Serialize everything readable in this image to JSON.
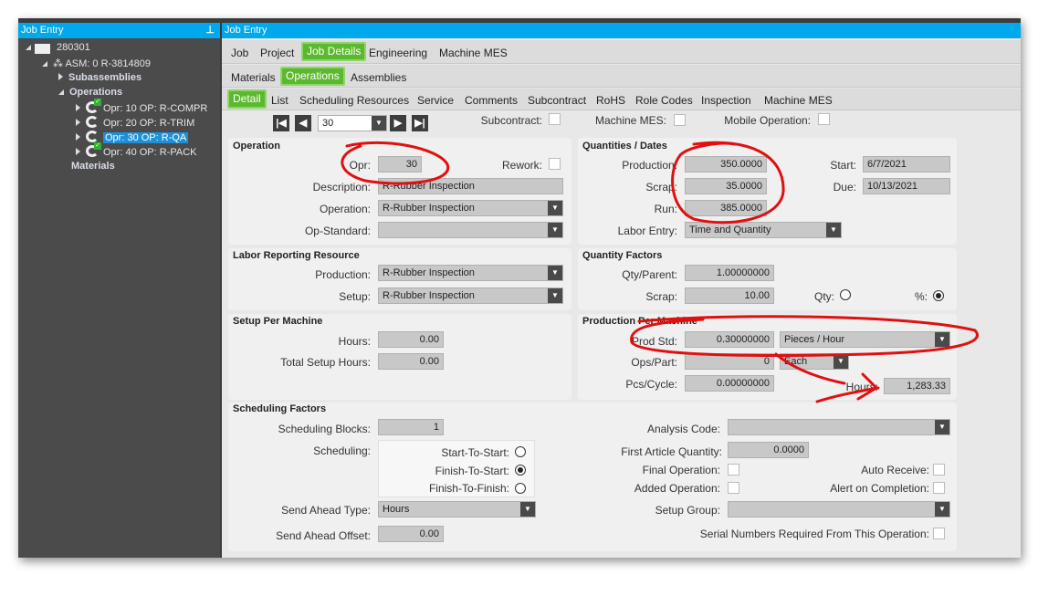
{
  "left_panel": {
    "title": "Job Entry",
    "pin_icon": "pin-icon",
    "tree": {
      "job": "280301",
      "assembly": "ASM: 0 R-3814809",
      "subassemblies": "Subassemblies",
      "operations": "Operations",
      "ops": [
        {
          "label": "Opr: 10 OP: R-COMPR",
          "complete": true
        },
        {
          "label": "Opr: 20 OP: R-TRIM",
          "complete": false
        },
        {
          "label": "Opr: 30 OP: R-QA",
          "complete": false,
          "selected": true
        },
        {
          "label": "Opr: 40 OP: R-PACK",
          "complete": true
        }
      ],
      "materials": "Materials"
    }
  },
  "main": {
    "title": "Job Entry",
    "tabs1": [
      "Job",
      "Project",
      "Job Details",
      "Engineering",
      "Machine MES"
    ],
    "tabs2": [
      "Materials",
      "Operations",
      "Assemblies"
    ],
    "tabs3": [
      "Detail",
      "List",
      "Scheduling Resources",
      "Service",
      "Comments",
      "Subcontract",
      "RoHS",
      "Role Codes",
      "Inspection",
      "Machine MES"
    ],
    "accent": "#5cb82e",
    "header_color": "#00a8ec",
    "nav": {
      "value": "30",
      "subcontract": "Subcontract:",
      "machine_mes": "Machine MES:",
      "mobile": "Mobile Operation:"
    }
  },
  "operation": {
    "title": "Operation",
    "opr_label": "Opr:",
    "opr": "30",
    "rework_label": "Rework:",
    "desc_label": "Description:",
    "desc": "R-Rubber Inspection",
    "op_label": "Operation:",
    "op": "R-Rubber Inspection",
    "std_label": "Op-Standard:",
    "std": ""
  },
  "quantities": {
    "title": "Quantities / Dates",
    "prod_label": "Production:",
    "prod": "350.0000",
    "scrap_label": "Scrap:",
    "scrap": "35.0000",
    "run_label": "Run:",
    "run": "385.0000",
    "labor_label": "Labor Entry:",
    "labor": "Time and Quantity",
    "start_label": "Start:",
    "start": "6/7/2021",
    "due_label": "Due:",
    "due": "10/13/2021"
  },
  "labor": {
    "title": "Labor Reporting Resource",
    "prod_label": "Production:",
    "prod": "R-Rubber Inspection",
    "setup_label": "Setup:",
    "setup": "R-Rubber Inspection"
  },
  "qty_factors": {
    "title": "Quantity Factors",
    "qp_label": "Qty/Parent:",
    "qp": "1.00000000",
    "scrap_label": "Scrap:",
    "scrap": "10.00",
    "qty_label": "Qty:",
    "pct_label": "%:",
    "selected": "%"
  },
  "setup": {
    "title": "Setup Per Machine",
    "hours_label": "Hours:",
    "hours": "0.00",
    "total_label": "Total Setup Hours:",
    "total": "0.00"
  },
  "prod_machine": {
    "title": "Production Per Machine",
    "std_label": "Prod Std:",
    "std": "0.30000000",
    "std_unit": "Pieces / Hour",
    "ops_label": "Ops/Part:",
    "ops": "0",
    "ops_unit": "Each",
    "pcs_label": "Pcs/Cycle:",
    "pcs": "0.00000000",
    "hours_label": "Hours:",
    "hours": "1,283.33"
  },
  "scheduling": {
    "title": "Scheduling Factors",
    "blocks_label": "Scheduling Blocks:",
    "blocks": "1",
    "sched_label": "Scheduling:",
    "opts": [
      "Start-To-Start:",
      "Finish-To-Start:",
      "Finish-To-Finish:"
    ],
    "selected": "Finish-To-Start:",
    "sat_label": "Send Ahead Type:",
    "sat": "Hours",
    "sao_label": "Send Ahead Offset:",
    "sao": "0.00",
    "analysis_label": "Analysis Code:",
    "analysis": "",
    "faq_label": "First Article Quantity:",
    "faq": "0.0000",
    "final_label": "Final Operation:",
    "auto_label": "Auto Receive:",
    "added_label": "Added Operation:",
    "alert_label": "Alert on Completion:",
    "sg_label": "Setup Group:",
    "sg": "",
    "serial_label": "Serial Numbers Required From This Operation:"
  },
  "annotation_color": "#e01010"
}
